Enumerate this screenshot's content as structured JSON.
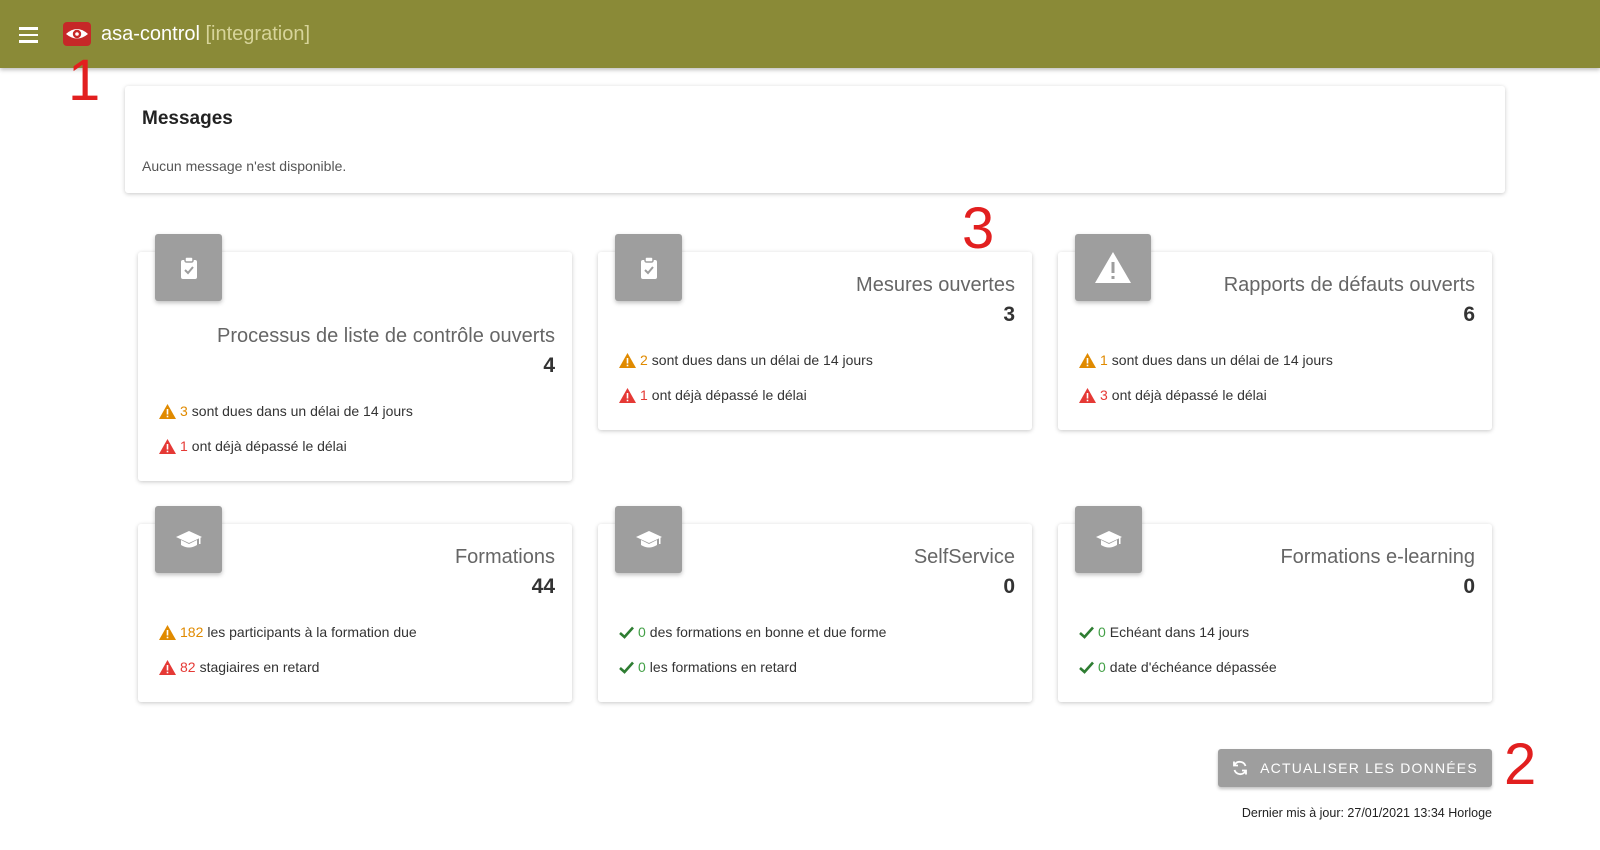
{
  "header": {
    "title": "asa-control",
    "environment": "[integration]",
    "bg_color": "#8a8a37"
  },
  "annotations": [
    "1",
    "2",
    "3"
  ],
  "messages": {
    "title": "Messages",
    "empty_text": "Aucun message n'est disponible."
  },
  "cards": [
    {
      "icon": "clipboard-check-icon",
      "title": "Processus de liste de contrôle ouverts",
      "value": "4",
      "stats": [
        {
          "status": "warning",
          "count": "3",
          "text": "sont dues dans un délai de 14 jours"
        },
        {
          "status": "error",
          "count": "1",
          "text": "ont déjà dépassé le délai"
        }
      ]
    },
    {
      "icon": "clipboard-check-icon",
      "title": "Mesures ouvertes",
      "value": "3",
      "stats": [
        {
          "status": "warning",
          "count": "2",
          "text": "sont dues dans un délai de 14 jours"
        },
        {
          "status": "error",
          "count": "1",
          "text": "ont déjà dépassé le délai"
        }
      ]
    },
    {
      "icon": "warning-triangle-icon",
      "title": "Rapports de défauts ouverts",
      "value": "6",
      "stats": [
        {
          "status": "warning",
          "count": "1",
          "text": "sont dues dans un délai de 14 jours"
        },
        {
          "status": "error",
          "count": "3",
          "text": "ont déjà dépassé le délai"
        }
      ]
    },
    {
      "icon": "graduation-cap-icon",
      "title": "Formations",
      "value": "44",
      "stats": [
        {
          "status": "warning",
          "count": "182",
          "text": "les participants à la formation due"
        },
        {
          "status": "error",
          "count": "82",
          "text": "stagiaires en retard"
        }
      ]
    },
    {
      "icon": "graduation-cap-icon",
      "title": "SelfService",
      "value": "0",
      "stats": [
        {
          "status": "ok",
          "count": "0",
          "text": "des formations en bonne et due forme"
        },
        {
          "status": "ok",
          "count": "0",
          "text": "les formations en retard"
        }
      ]
    },
    {
      "icon": "graduation-cap-icon",
      "title": "Formations e-learning",
      "value": "0",
      "stats": [
        {
          "status": "ok",
          "count": "0",
          "text": "Echéant dans 14 jours"
        },
        {
          "status": "ok",
          "count": "0",
          "text": "date d'échéance dépassée"
        }
      ]
    }
  ],
  "refresh": {
    "label": "ACTUALISER LES DONNÉES",
    "icon": "refresh-icon"
  },
  "last_update": "Dernier mis à jour: 27/01/2021 13:34 Horloge",
  "colors": {
    "warning": "#e08a00",
    "error": "#e53935",
    "ok": "#43a047",
    "icon_bg": "#9e9e9e"
  }
}
